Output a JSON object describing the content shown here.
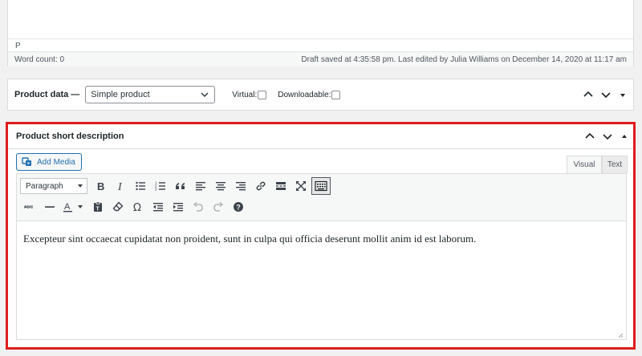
{
  "top_editor": {
    "path": "P",
    "word_count": "Word count: 0",
    "draft_status": "Draft saved at 4:35:58 pm. Last edited by Julia Williams on December 14, 2020 at 11:17 am"
  },
  "product_data": {
    "title": "Product data —",
    "type_select": "Simple product",
    "virtual_label": "Virtual:",
    "downloadable_label": "Downloadable:"
  },
  "short_description": {
    "title": "Product short description",
    "add_media_label": "Add Media",
    "tabs": {
      "visual": "Visual",
      "text": "Text"
    },
    "format_select": "Paragraph",
    "content": "Excepteur sint occaecat cupidatat non proident, sunt in culpa qui officia deserunt mollit anim id est laborum."
  },
  "colors": {
    "highlight_border": "#e01b1b",
    "accent_blue": "#2271b1"
  },
  "icons": {
    "toolbar_row1": [
      "bold-icon",
      "italic-icon",
      "bullet-list-icon",
      "numbered-list-icon",
      "blockquote-icon",
      "align-left-icon",
      "align-center-icon",
      "align-right-icon",
      "link-icon",
      "read-more-icon",
      "fullscreen-icon",
      "toolbar-toggle-icon"
    ],
    "toolbar_row2": [
      "strikethrough-icon",
      "horizontal-line-icon",
      "text-color-icon",
      "paste-text-icon",
      "clear-formatting-icon",
      "special-character-icon",
      "outdent-icon",
      "indent-icon",
      "undo-icon",
      "redo-icon",
      "help-icon"
    ]
  }
}
